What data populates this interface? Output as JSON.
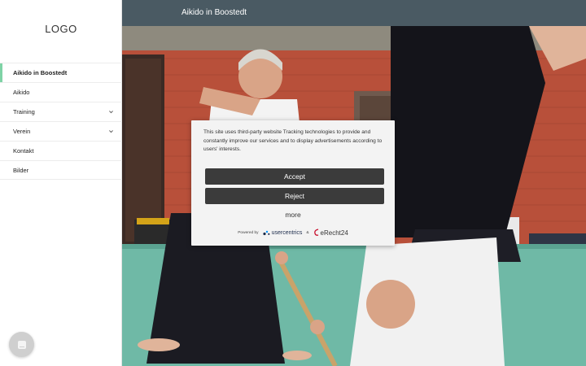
{
  "sidebar": {
    "logo": "LOGO",
    "items": [
      {
        "label": "Aikido in Boostedt",
        "active": true,
        "has_submenu": false
      },
      {
        "label": "Aikido",
        "active": false,
        "has_submenu": false
      },
      {
        "label": "Training",
        "active": false,
        "has_submenu": true
      },
      {
        "label": "Verein",
        "active": false,
        "has_submenu": true
      },
      {
        "label": "Kontakt",
        "active": false,
        "has_submenu": false
      },
      {
        "label": "Bilder",
        "active": false,
        "has_submenu": false
      }
    ],
    "active_color": "#7fd3a6",
    "chat_icon": "chat-icon"
  },
  "header": {
    "title": "Aikido in Boostedt",
    "background": "#4a5a63"
  },
  "consent": {
    "text": "This site uses third-party website Tracking technologies to provide and constantly improve our services and to display advertisements according to users' interests.",
    "accept_label": "Accept",
    "reject_label": "Reject",
    "more_label": "more",
    "powered_by_label": "Powered by",
    "brand_one": "usercentrics",
    "ampersand": "&",
    "brand_two": "eRecht24",
    "brand_two_mark": "e"
  }
}
